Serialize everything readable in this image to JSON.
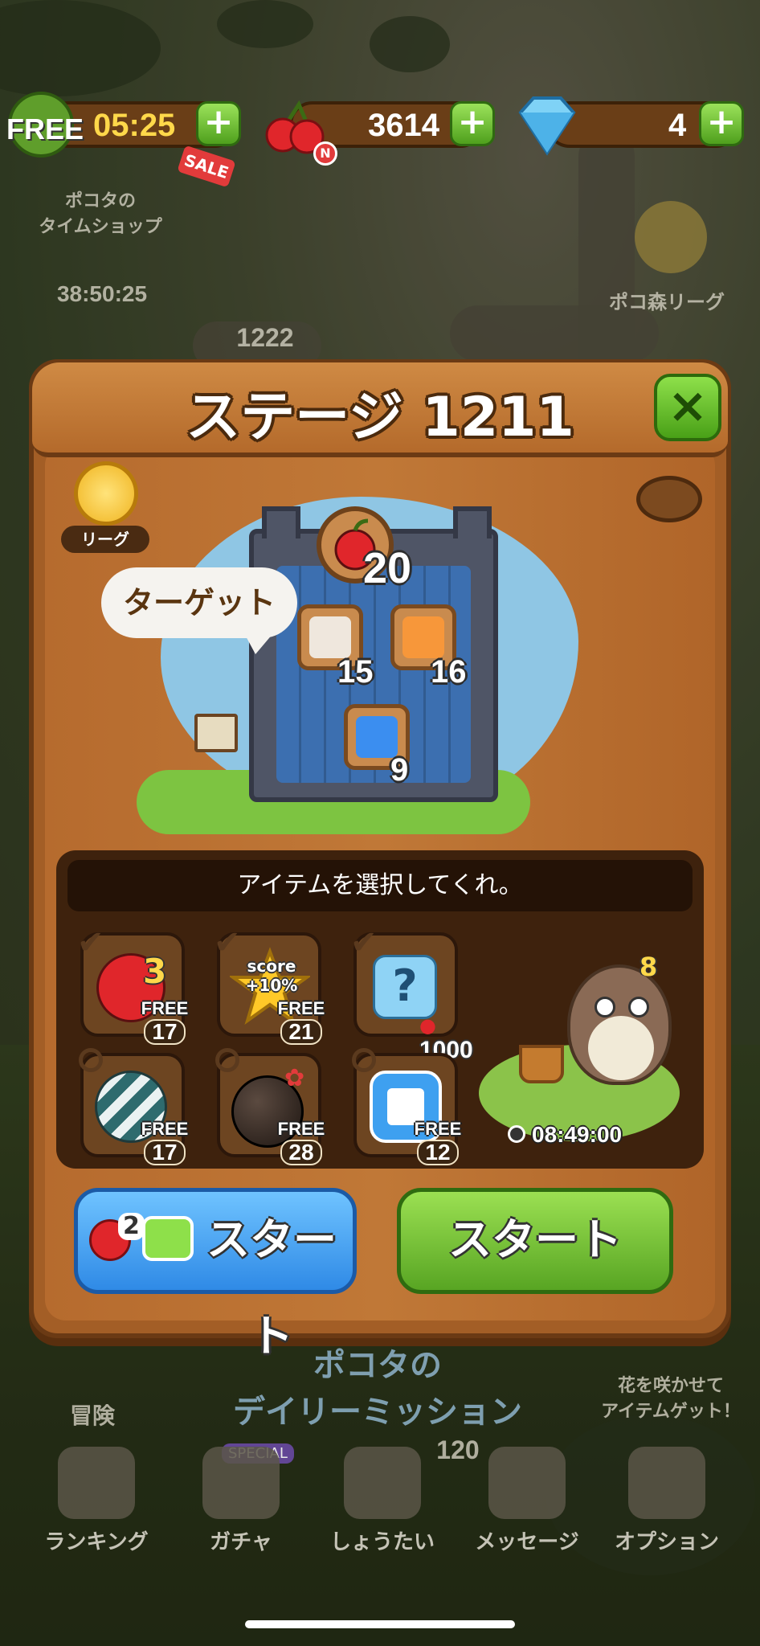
{
  "hud": {
    "lives_label": "FREE",
    "lives_timer": "05:25",
    "sale_tag": "SALE",
    "cherries": "3614",
    "cherry_badge": "N",
    "gems": "4",
    "plus": "+"
  },
  "background": {
    "timeshop_label": "ポコタの\nタイムショップ",
    "timeshop_timer": "38:50:25",
    "league_label": "ポコ森リーグ",
    "stage_marker_1222": "1222",
    "stage_marker_120": "120",
    "daily_mission": "ポコタの\nデイリーミッション",
    "adventure": "冒険",
    "flower_hint": "花を咲かせて\nアイテムゲット！"
  },
  "modal": {
    "title": "ステージ 1211",
    "close": "×",
    "league_badge": "リーグ",
    "target_bubble": "ターゲット",
    "targets": [
      {
        "name": "apple",
        "count": "20"
      },
      {
        "name": "white-block",
        "count": "15"
      },
      {
        "name": "orange-block",
        "count": "16"
      },
      {
        "name": "blue-block",
        "count": "9"
      }
    ],
    "items_header": "アイテムを選択してくれ。",
    "items": [
      {
        "name": "apple-bonus",
        "badge": "3",
        "free_label": "FREE",
        "free_count": "17",
        "checked": true
      },
      {
        "name": "score-star",
        "badge": "score\n+10%",
        "free_label": "FREE",
        "free_count": "21",
        "checked": true
      },
      {
        "name": "random-item",
        "badge": "",
        "price": "1000",
        "checked": true
      },
      {
        "name": "spiral-shell",
        "badge": "",
        "free_label": "FREE",
        "free_count": "17",
        "checked": false
      },
      {
        "name": "bomb",
        "badge": "",
        "free_label": "FREE",
        "free_count": "28",
        "checked": false
      },
      {
        "name": "block-bomb",
        "badge": "",
        "free_label": "FREE",
        "free_count": "12",
        "checked": false
      }
    ],
    "owl_badge": "8",
    "owl_timer": "08:49:00",
    "start_ad_count": "2",
    "start_ad_label": "スタート",
    "start_label": "スタート"
  },
  "nav": {
    "ranking": "ランキング",
    "gacha": "ガチャ",
    "gacha_badge": "SPECIAL",
    "invite": "しょうたい",
    "message": "メッセージ",
    "option": "オプション"
  },
  "colors": {
    "wood": "#a35e26",
    "wood_dark": "#6b3a14",
    "green_btn": "#58a523",
    "blue_btn": "#2f8ae6"
  }
}
